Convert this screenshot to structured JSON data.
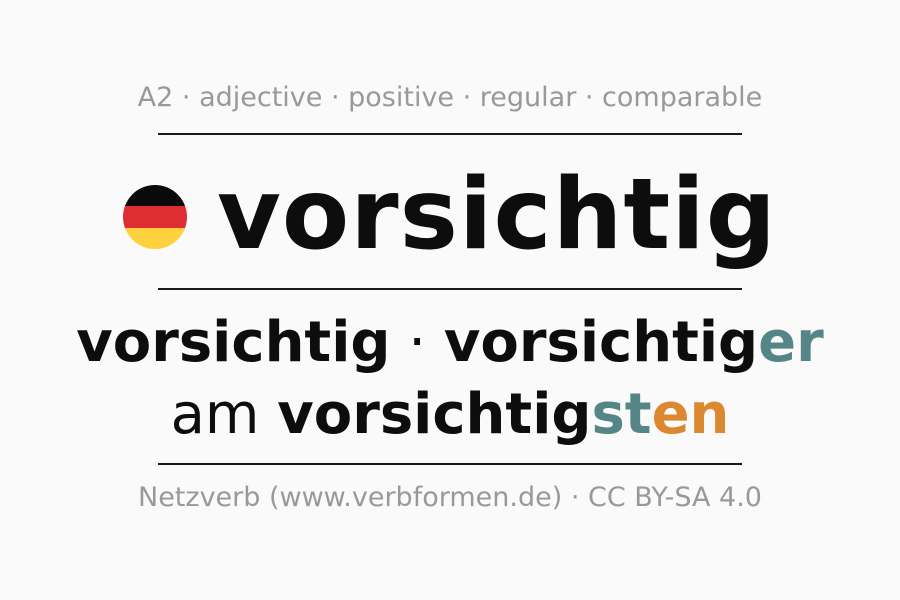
{
  "meta_line": "A2 · adjective · positive · regular · comparable",
  "flag": {
    "name": "germany-flag",
    "colors": [
      "#0a0a0a",
      "#dd2e34",
      "#ffd23d"
    ]
  },
  "headword": "vorsichtig",
  "forms": {
    "positive": "vorsichtig",
    "separator": " · ",
    "comparative_stem": "vorsichtig",
    "comparative_ending": "er",
    "superlative_prefix": "am ",
    "superlative_stem": "vorsichtig",
    "superlative_ending_1": "st",
    "superlative_ending_2": "en"
  },
  "colors": {
    "ending_teal": "#558586",
    "ending_orange": "#db8831",
    "muted_text": "#999999",
    "main_text": "#0d0d0d"
  },
  "footer": "Netzverb (www.verbformen.de) · CC BY-SA 4.0"
}
